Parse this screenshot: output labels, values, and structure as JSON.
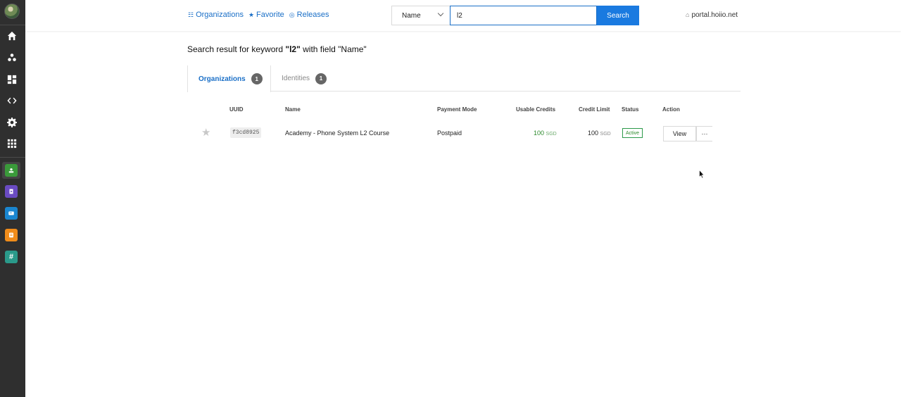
{
  "sidebar": {
    "nav": [
      {
        "icon": "home-icon"
      },
      {
        "icon": "users-icon"
      },
      {
        "icon": "dashboard-icon"
      },
      {
        "icon": "code-icon"
      },
      {
        "icon": "gear-icon"
      },
      {
        "icon": "apps-grid-icon"
      }
    ],
    "apps": [
      {
        "icon": "app-green-icon",
        "color": "#3a9a3a"
      },
      {
        "icon": "app-purple-icon",
        "color": "#6a4bc2"
      },
      {
        "icon": "app-blue-icon",
        "color": "#1a86d0"
      },
      {
        "icon": "app-orange-icon",
        "color": "#f08c1a"
      },
      {
        "icon": "app-teal-icon",
        "color": "#2a9a8a",
        "glyph": "#"
      }
    ]
  },
  "topbar": {
    "links": [
      {
        "glyph": "☷",
        "label": "Organizations"
      },
      {
        "glyph": "★",
        "label": "Favorite"
      },
      {
        "glyph": "◎",
        "label": "Releases"
      }
    ],
    "field_select": "Name",
    "search_value": "l2",
    "search_button": "Search",
    "portal": "portal.hoiio.net"
  },
  "main": {
    "result_prefix": "Search result for keyword ",
    "keyword": "\"l2\"",
    "result_middle": " with field ",
    "field": "\"Name\"",
    "tabs": [
      {
        "label": "Organizations",
        "count": "1"
      },
      {
        "label": "Identities",
        "count": "1"
      }
    ],
    "columns": {
      "uuid": "UUID",
      "name": "Name",
      "payment_mode": "Payment Mode",
      "usable_credits": "Usable Credits",
      "credit_limit": "Credit Limit",
      "status": "Status",
      "action": "Action"
    },
    "rows": [
      {
        "uuid": "f3cd8925",
        "name": "Academy - Phone System L2 Course",
        "payment_mode": "Postpaid",
        "usable_credits": "100",
        "credits_unit": "SGD",
        "credit_limit": "100",
        "limit_unit": "SGD",
        "status": "Active",
        "view_label": "View",
        "more_label": "···"
      }
    ]
  }
}
